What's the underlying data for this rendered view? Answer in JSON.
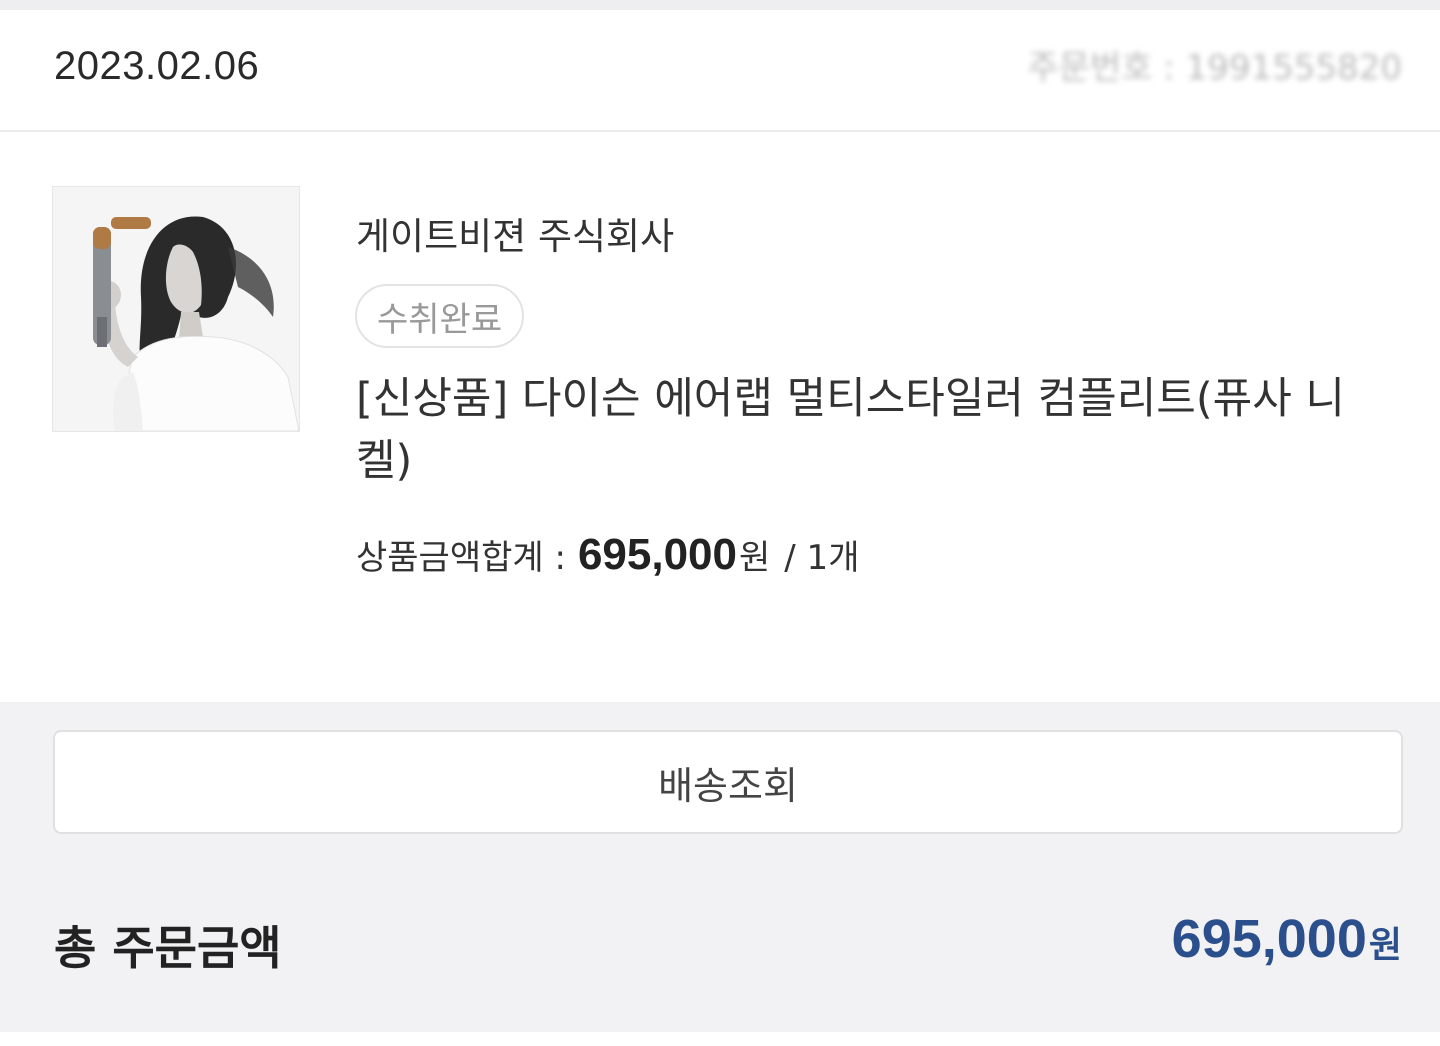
{
  "order": {
    "date": "2023.02.06",
    "number_masked": "주문번호 : 1991555820"
  },
  "item": {
    "seller": "게이트비젼 주식회사",
    "status": "수취완료",
    "product_name": "[신상품] 다이슨 에어랩 멀티스타일러 컴플리트(퓨사 니켈)",
    "subtotal_label": "상품금액합계 :",
    "subtotal_amount": "695,000",
    "currency": "원",
    "quantity": "/ 1개",
    "image_icon": "product-photo"
  },
  "actions": {
    "track_label": "배송조회"
  },
  "summary": {
    "total_label": "총 주문금액",
    "total_amount": "695,000",
    "currency": "원"
  },
  "colors": {
    "accent": "#2b4f8c",
    "status_text": "#999999",
    "background": "#f2f2f4"
  }
}
